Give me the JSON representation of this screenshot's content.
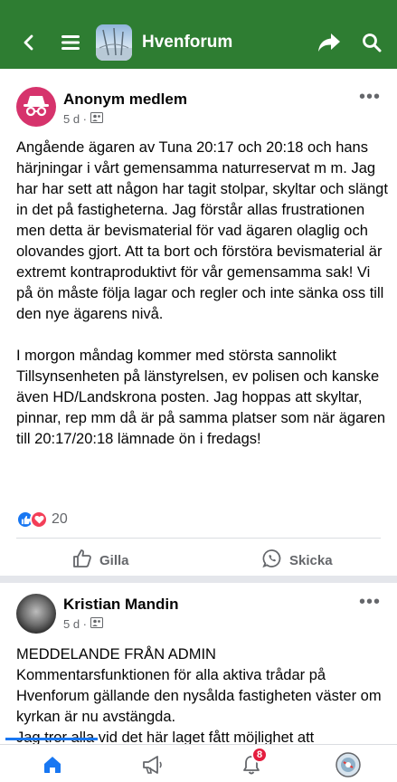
{
  "app": {
    "title": "Hvenforum",
    "colors": {
      "bar": "#2e7d32",
      "accent": "#1877f2",
      "badge": "#e41e3f"
    },
    "icons": [
      "back-icon",
      "menu-icon",
      "share-icon",
      "search-icon"
    ]
  },
  "posts": [
    {
      "author": "Anonym medlem",
      "time": "5 d ·",
      "text": "Angående ägaren av Tuna 20:17 och 20:18 och hans härjningar i vårt gemensamma naturreservat m m. Jag har har sett att någon har tagit stolpar, skyltar och slängt in det på fastigheterna. Jag förstår allas frustrationen men detta är bevismaterial för vad ägaren olaglig och olovandes gjort. Att ta bort och förstöra bevismaterial är extremt kontraproduktivt för vår gemensamma sak! Vi på ön måste följa lagar och regler och inte sänka oss till den nye ägarens nivå.\n\nI morgon måndag kommer med största sannolikt Tillsynsenheten på länstyrelsen, ev polisen och kanske även HD/Landskrona posten. Jag hoppas att skyltar, pinnar, rep mm då är på samma platser som när ägaren till 20:17/20:18 lämnade ön i fredags!",
      "reactions_count": "20",
      "like_label": "Gilla",
      "send_label": "Skicka"
    },
    {
      "author": "Kristian Mandin",
      "time": "5 d ·",
      "text": "MEDDELANDE FRÅN ADMIN\nKommentarsfunktionen för alla aktiva trådar på Hvenforum gällande den nysålda fastigheten väster om kyrkan är nu avstängda.\nJag tror alla vid det här laget fått möjlighet att"
    }
  ],
  "nav": {
    "items": [
      "home-icon",
      "megaphone-icon",
      "bell-icon",
      "profile-icon"
    ],
    "notification_count": "8"
  }
}
